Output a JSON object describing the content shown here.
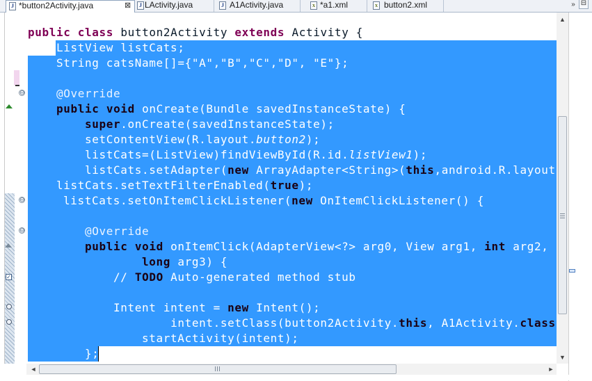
{
  "tabs": [
    {
      "label": "*button2Activity.java",
      "icon": "java-file-icon",
      "active": true
    },
    {
      "label": "LActivity.java",
      "icon": "java-file-icon",
      "active": false
    },
    {
      "label": "A1Activity.java",
      "icon": "java-file-icon",
      "active": false
    },
    {
      "label": "*a1.xml",
      "icon": "xml-file-icon",
      "active": false
    },
    {
      "label": "button2.xml",
      "icon": "xml-file-icon",
      "active": false
    }
  ],
  "tab_close_glyph": "⊠",
  "tab_overflow_glyph": "»",
  "window_minimize_glyph": "⊟",
  "code": {
    "line1": {
      "kw_public": "public",
      "kw_class": "class",
      "name": "button2Activity",
      "kw_extends": "extends",
      "rest": "Activity {"
    },
    "line2": "ListView listCats;",
    "line3": "String catsName[]={\"A\",\"B\",\"C\",\"D\", \"E\"};",
    "line4": "@Override",
    "line5": {
      "kw_public": "public",
      "kw_void": "void",
      "rest": "onCreate(Bundle savedInstanceState) {"
    },
    "line6": {
      "kw_super": "super",
      "rest": ".onCreate(savedInstanceState);"
    },
    "line7": {
      "pre": "setContentView(R.layout.",
      "ital": "button2",
      "post": ");"
    },
    "line8": {
      "pre": "listCats=(ListView)findViewById(R.id.",
      "ital": "listView1",
      "post": ");"
    },
    "line9": {
      "pre": "listCats.setAdapter(",
      "kw_new": "new",
      "mid": " ArrayAdapter<String>(",
      "kw_this": "this",
      "post": ",android.R.layout.s"
    },
    "line10": {
      "pre": "listCats.setTextFilterEnabled(",
      "kw_true": "true",
      "post": ");"
    },
    "line11": {
      "pre": "listCats.setOnItemClickListener(",
      "kw_new": "new",
      "post": " OnItemClickListener() {"
    },
    "line12": "@Override",
    "line13": {
      "kw_public": "public",
      "kw_void": "void",
      "pre": "onItemClick(AdapterView<?> arg0, View arg1, ",
      "kw_int": "int",
      "post": " arg2,"
    },
    "line14": {
      "kw_long": "long",
      "post": " arg3) {"
    },
    "line15": {
      "pre": "// ",
      "kw_todo": "TODO",
      "post": " Auto-generated method stub"
    },
    "line16": {
      "pre": "Intent intent = ",
      "kw_new": "new",
      "post": " Intent();"
    },
    "line17": {
      "pre": "intent.setClass(button2Activity.",
      "kw_this": "this",
      "mid": ", A1Activity.",
      "kw_class": "class",
      "post": ");"
    },
    "line18": "startActivity(intent);",
    "line19": "};"
  },
  "colors": {
    "selection": "#3399ff",
    "keyword": "#7f0055",
    "tab_bar": "#eef1f6"
  },
  "icons": {
    "fold_minus": "⊖",
    "task_marker": "✓",
    "scroll_up": "▲",
    "scroll_down": "▼",
    "scroll_left": "◄",
    "scroll_right": "►"
  }
}
